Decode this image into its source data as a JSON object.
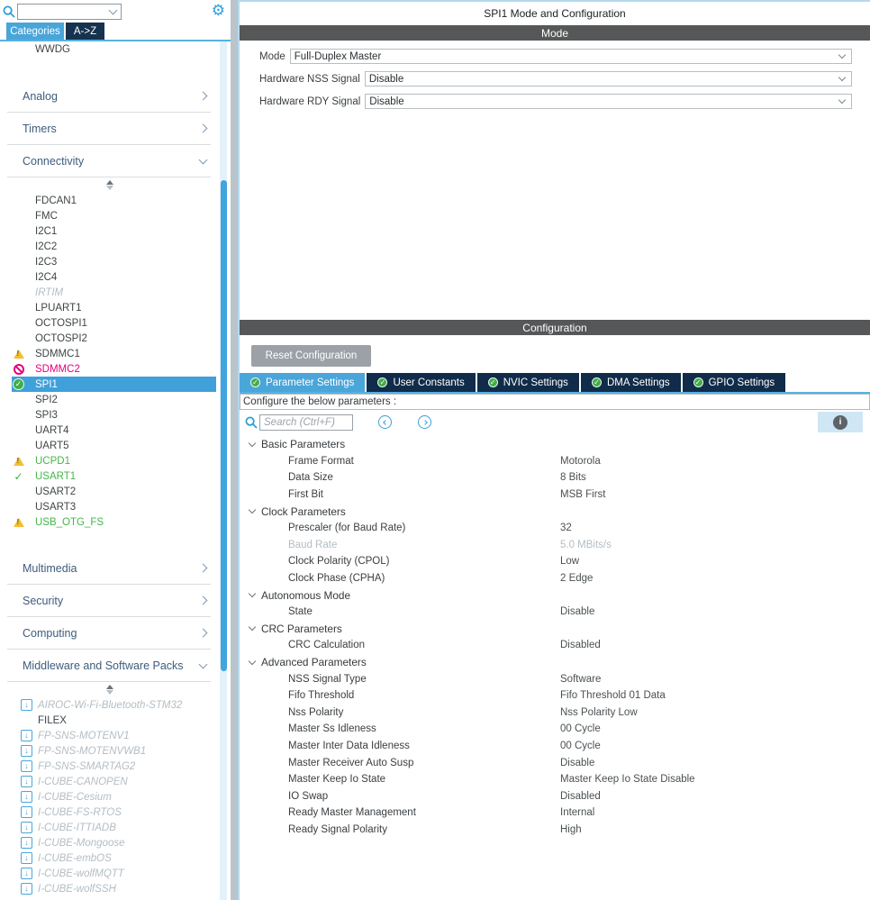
{
  "topbar": {
    "search_placeholder": "",
    "gear_icon": "settings-gear",
    "tabs": {
      "categories": "Categories",
      "az": "A->Z"
    }
  },
  "sidebar": {
    "scrolled_item": "WWDG",
    "categories": [
      {
        "label": "Analog",
        "expanded": false
      },
      {
        "label": "Timers",
        "expanded": false
      },
      {
        "label": "Connectivity",
        "expanded": true
      },
      {
        "label": "Multimedia",
        "expanded": false
      },
      {
        "label": "Security",
        "expanded": false
      },
      {
        "label": "Computing",
        "expanded": false
      },
      {
        "label": "Middleware and Software Packs",
        "expanded": true
      }
    ],
    "connectivity_items": [
      {
        "label": "FDCAN1",
        "icon": "none",
        "state": "normal"
      },
      {
        "label": "FMC",
        "icon": "none",
        "state": "normal"
      },
      {
        "label": "I2C1",
        "icon": "none",
        "state": "normal"
      },
      {
        "label": "I2C2",
        "icon": "none",
        "state": "normal"
      },
      {
        "label": "I2C3",
        "icon": "none",
        "state": "normal"
      },
      {
        "label": "I2C4",
        "icon": "none",
        "state": "normal"
      },
      {
        "label": "IRTIM",
        "icon": "none",
        "state": "unavailable"
      },
      {
        "label": "LPUART1",
        "icon": "none",
        "state": "normal"
      },
      {
        "label": "OCTOSPI1",
        "icon": "none",
        "state": "normal"
      },
      {
        "label": "OCTOSPI2",
        "icon": "none",
        "state": "normal"
      },
      {
        "label": "SDMMC1",
        "icon": "warning",
        "state": "normal"
      },
      {
        "label": "SDMMC2",
        "icon": "not-configurable",
        "state": "conflict"
      },
      {
        "label": "SPI1",
        "icon": "check-circle",
        "state": "selected"
      },
      {
        "label": "SPI2",
        "icon": "none",
        "state": "normal"
      },
      {
        "label": "SPI3",
        "icon": "none",
        "state": "normal"
      },
      {
        "label": "UART4",
        "icon": "none",
        "state": "normal"
      },
      {
        "label": "UART5",
        "icon": "none",
        "state": "normal"
      },
      {
        "label": "UCPD1",
        "icon": "warning",
        "state": "active"
      },
      {
        "label": "USART1",
        "icon": "check",
        "state": "active"
      },
      {
        "label": "USART2",
        "icon": "none",
        "state": "normal"
      },
      {
        "label": "USART3",
        "icon": "none",
        "state": "normal"
      },
      {
        "label": "USB_OTG_FS",
        "icon": "warning",
        "state": "active"
      }
    ],
    "middleware_items": [
      {
        "label": "AIROC-Wi-Fi-Bluetooth-STM32",
        "icon": "download"
      },
      {
        "label": "FILEX",
        "icon": "none"
      },
      {
        "label": "FP-SNS-MOTENV1",
        "icon": "download"
      },
      {
        "label": "FP-SNS-MOTENVWB1",
        "icon": "download"
      },
      {
        "label": "FP-SNS-SMARTAG2",
        "icon": "download"
      },
      {
        "label": "I-CUBE-CANOPEN",
        "icon": "download"
      },
      {
        "label": "I-CUBE-Cesium",
        "icon": "download"
      },
      {
        "label": "I-CUBE-FS-RTOS",
        "icon": "download"
      },
      {
        "label": "I-CUBE-ITTIADB",
        "icon": "download"
      },
      {
        "label": "I-CUBE-Mongoose",
        "icon": "download"
      },
      {
        "label": "I-CUBE-embOS",
        "icon": "download"
      },
      {
        "label": "I-CUBE-wolfMQTT",
        "icon": "download"
      },
      {
        "label": "I-CUBE-wolfSSH",
        "icon": "download"
      }
    ]
  },
  "mode_panel": {
    "title": "SPI1 Mode and Configuration",
    "section_title": "Mode",
    "rows": [
      {
        "label": "Mode",
        "value": "Full-Duplex Master"
      },
      {
        "label": "Hardware NSS Signal",
        "value": "Disable"
      },
      {
        "label": "Hardware RDY Signal",
        "value": "Disable"
      }
    ]
  },
  "config_panel": {
    "section_title": "Configuration",
    "reset_button": "Reset Configuration",
    "tabs": [
      {
        "label": "Parameter Settings",
        "active": true
      },
      {
        "label": "User Constants",
        "active": false
      },
      {
        "label": "NVIC Settings",
        "active": false
      },
      {
        "label": "DMA Settings",
        "active": false
      },
      {
        "label": "GPIO Settings",
        "active": false
      }
    ],
    "hint": "Configure the below parameters :",
    "search_placeholder": "Search (Ctrl+F)",
    "info_icon": "i",
    "params": [
      {
        "type": "group",
        "label": "Basic Parameters"
      },
      {
        "type": "item",
        "label": "Frame Format",
        "value": "Motorola"
      },
      {
        "type": "item",
        "label": "Data Size",
        "value": "8 Bits"
      },
      {
        "type": "item",
        "label": "First Bit",
        "value": "MSB First"
      },
      {
        "type": "group",
        "label": "Clock Parameters"
      },
      {
        "type": "item",
        "label": "Prescaler (for Baud Rate)",
        "value": "32"
      },
      {
        "type": "item",
        "label": "Baud Rate",
        "value": "5.0 MBits/s",
        "dim": true
      },
      {
        "type": "item",
        "label": "Clock Polarity (CPOL)",
        "value": "Low"
      },
      {
        "type": "item",
        "label": "Clock Phase (CPHA)",
        "value": "2 Edge"
      },
      {
        "type": "group",
        "label": "Autonomous Mode"
      },
      {
        "type": "item",
        "label": "State",
        "value": "Disable"
      },
      {
        "type": "group",
        "label": "CRC Parameters"
      },
      {
        "type": "item",
        "label": "CRC Calculation",
        "value": "Disabled"
      },
      {
        "type": "group",
        "label": "Advanced Parameters"
      },
      {
        "type": "item",
        "label": "NSS Signal Type",
        "value": "Software"
      },
      {
        "type": "item",
        "label": "Fifo Threshold",
        "value": "Fifo Threshold 01 Data"
      },
      {
        "type": "item",
        "label": "Nss Polarity",
        "value": "Nss Polarity Low"
      },
      {
        "type": "item",
        "label": "Master Ss Idleness",
        "value": "00 Cycle"
      },
      {
        "type": "item",
        "label": "Master Inter Data Idleness",
        "value": "00 Cycle"
      },
      {
        "type": "item",
        "label": "Master Receiver Auto Susp",
        "value": "Disable"
      },
      {
        "type": "item",
        "label": "Master Keep Io State",
        "value": "Master Keep Io State Disable"
      },
      {
        "type": "item",
        "label": "IO Swap",
        "value": "Disabled"
      },
      {
        "type": "item",
        "label": "Ready Master Management",
        "value": "Internal"
      },
      {
        "type": "item",
        "label": "Ready Signal Polarity",
        "value": "High"
      }
    ]
  }
}
